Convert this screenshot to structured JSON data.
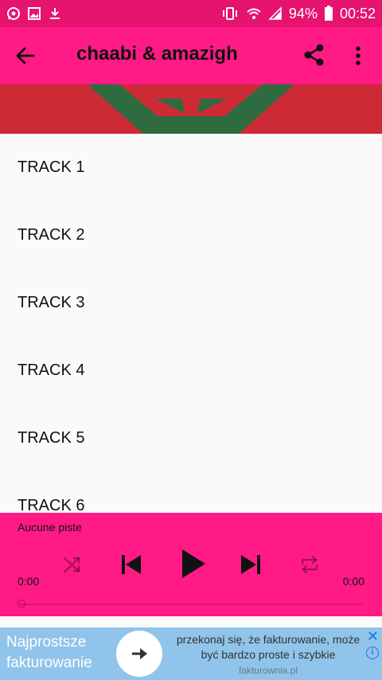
{
  "status_bar": {
    "battery": "94%",
    "time": "00:52"
  },
  "app_bar": {
    "title": "chaabi & amazigh"
  },
  "tracks": [
    "TRACK 1",
    "TRACK 2",
    "TRACK 3",
    "TRACK 4",
    "TRACK 5",
    "TRACK 6"
  ],
  "player": {
    "now_playing": "Aucune piste",
    "elapsed": "0:00",
    "duration": "0:00",
    "progress": 0
  },
  "ad": {
    "headline": "Najprostsze fakturowanie",
    "body": "przekonaj się, że fakturowanie, może być bardzo proste i szybkie",
    "domain": "fakturownia.pl",
    "close_label": "✕",
    "info_label": "i"
  },
  "colors": {
    "primary": "#ff1a86",
    "status": "#e6136f",
    "flag_red": "#cc2b36",
    "flag_green": "#2e6b3f",
    "ad_bg": "#90c4ea"
  }
}
